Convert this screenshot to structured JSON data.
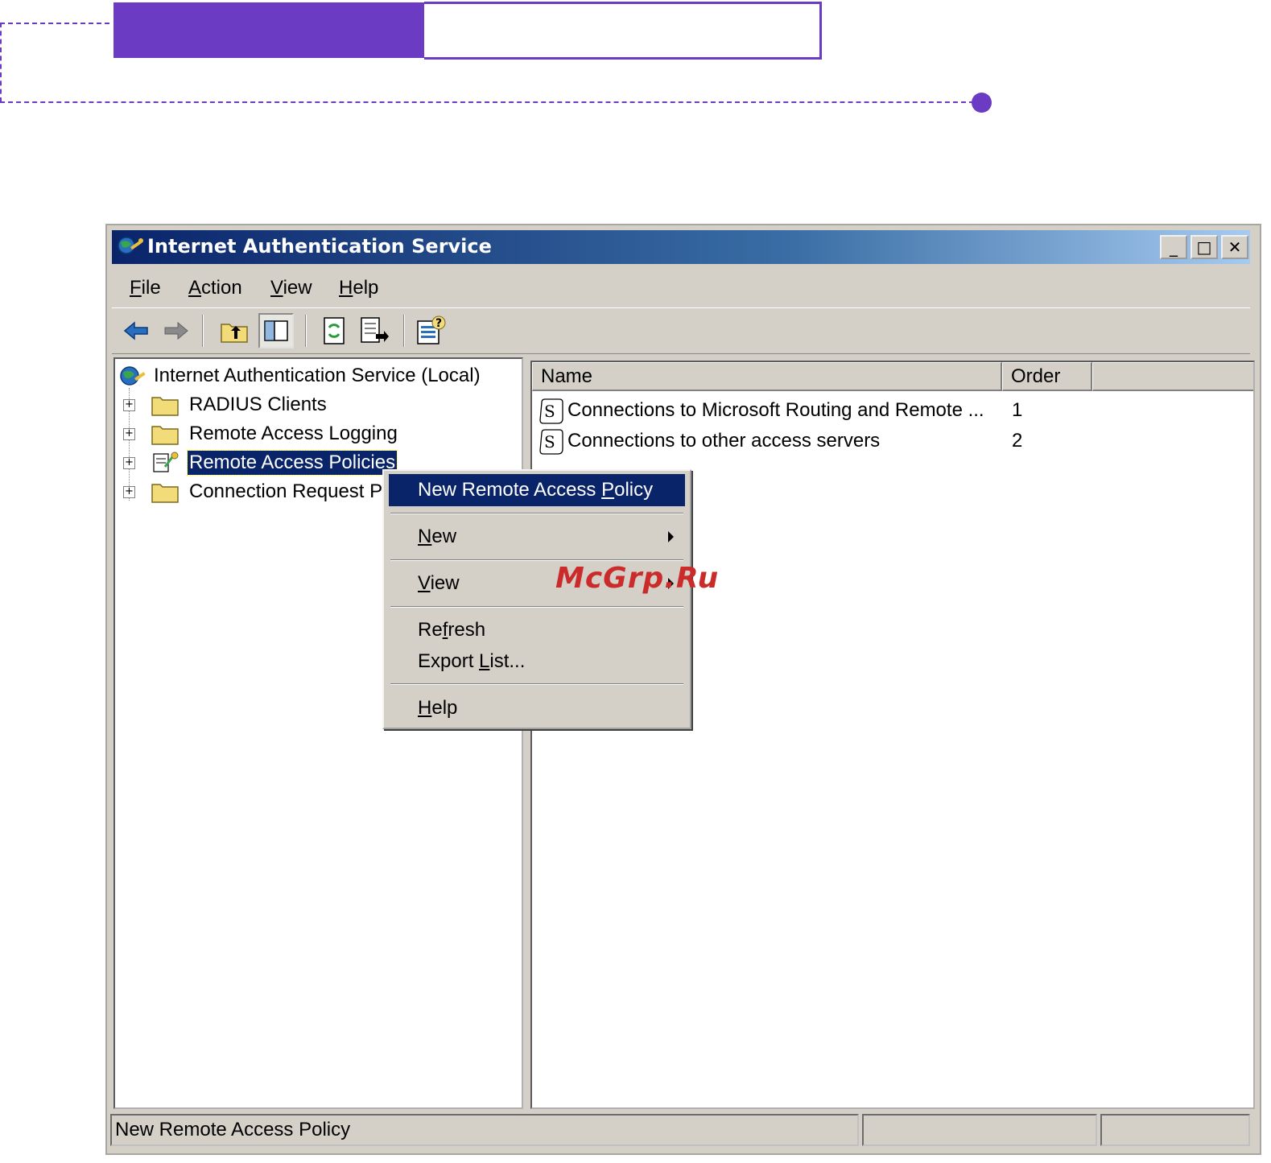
{
  "window": {
    "title": "Internet Authentication Service",
    "controls": {
      "minimize": "_",
      "maximize": "□",
      "close": "✕"
    }
  },
  "menubar": {
    "items": [
      {
        "label": "File",
        "underline": "F"
      },
      {
        "label": "Action",
        "underline": "A"
      },
      {
        "label": "View",
        "underline": "V"
      },
      {
        "label": "Help",
        "underline": "H"
      }
    ]
  },
  "toolbar": {
    "buttons": [
      "back-arrow-icon",
      "forward-arrow-icon",
      "up-one-level-icon",
      "show-hide-console-tree-icon",
      "refresh-icon",
      "export-list-icon",
      "help-icon"
    ]
  },
  "tree": {
    "root": "Internet Authentication Service (Local)",
    "nodes": [
      {
        "label": "RADIUS Clients",
        "expander": "+"
      },
      {
        "label": "Remote Access Logging",
        "expander": "+"
      },
      {
        "label": "Remote Access Policies",
        "expander": "+",
        "selected": true
      },
      {
        "label": "Connection Request Pr",
        "expander": "+"
      }
    ]
  },
  "list": {
    "columns": [
      "Name",
      "Order"
    ],
    "rows": [
      {
        "name": "Connections to Microsoft Routing and Remote ...",
        "order": "1"
      },
      {
        "name": "Connections to other access servers",
        "order": "2"
      }
    ]
  },
  "context_menu": {
    "items": [
      {
        "label": "New Remote Access Policy",
        "highlighted": true
      },
      {
        "label": "New",
        "submenu": true
      },
      {
        "label": "View",
        "submenu": true
      },
      {
        "label": "Refresh"
      },
      {
        "label": "Export List..."
      },
      {
        "label": "Help"
      }
    ]
  },
  "statusbar": {
    "text": "New Remote Access Policy"
  },
  "watermark": "McGrp.Ru",
  "colors": {
    "accent_purple": "#6b3cc3",
    "titlebar_dark": "#0a246a",
    "selection": "#0a246a",
    "window_face": "#d4d0c8"
  }
}
